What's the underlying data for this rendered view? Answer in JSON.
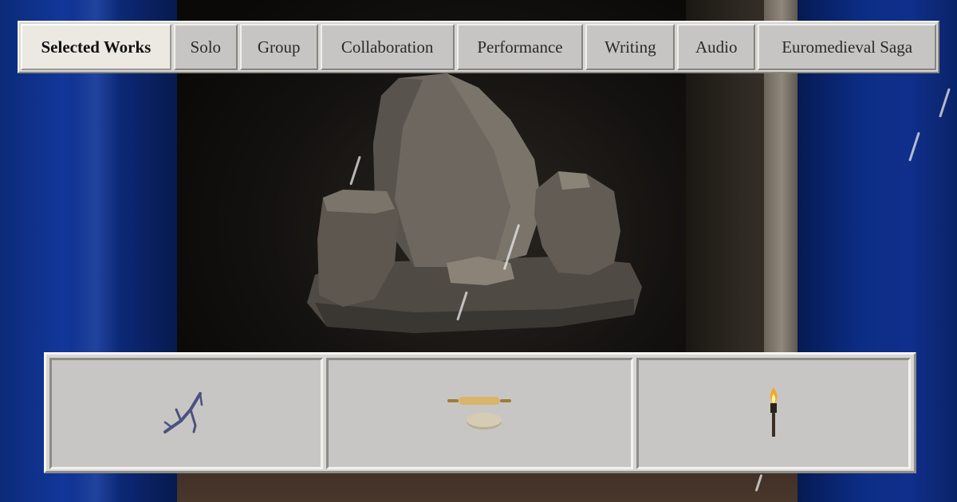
{
  "nav": {
    "tabs": [
      {
        "label": "Selected Works",
        "active": true
      },
      {
        "label": "Solo",
        "active": false
      },
      {
        "label": "Group",
        "active": false
      },
      {
        "label": "Collaboration",
        "active": false
      },
      {
        "label": "Performance",
        "active": false
      },
      {
        "label": "Writing",
        "active": false
      },
      {
        "label": "Audio",
        "active": false
      },
      {
        "label": "Euromedieval Saga",
        "active": false
      }
    ]
  },
  "drawer": {
    "items": [
      {
        "icon": "twig-icon"
      },
      {
        "icon": "rolling-pin-coin-icon"
      },
      {
        "icon": "torch-icon"
      }
    ]
  },
  "colors": {
    "curtain_blue": "#12379a",
    "panel_gray": "#c7c6c4",
    "active_tab": "#ece9e3"
  }
}
